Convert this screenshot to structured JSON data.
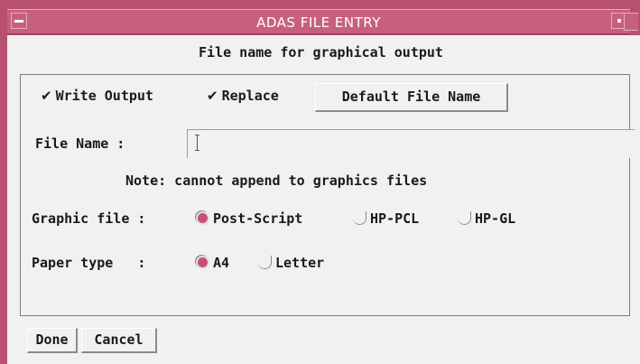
{
  "window": {
    "title": "ADAS FILE ENTRY"
  },
  "header": {
    "text": "File name for graphical output"
  },
  "options": {
    "write_output": {
      "label": "Write Output",
      "checked": true
    },
    "replace": {
      "label": "Replace",
      "checked": true
    },
    "default_button": "Default File Name"
  },
  "file_name": {
    "label": "File Name :",
    "value": ""
  },
  "note": "Note: cannot append to graphics files",
  "graphic_file": {
    "label": "Graphic file :",
    "options": [
      "Post-Script",
      "HP-PCL",
      "HP-GL"
    ],
    "selected": "Post-Script"
  },
  "paper_type": {
    "label": "Paper type   :",
    "options": [
      "A4",
      "Letter"
    ],
    "selected": "A4"
  },
  "footer": {
    "done": "Done",
    "cancel": "Cancel"
  },
  "colors": {
    "title_bar": "#c7607f",
    "frame": "#b8506f",
    "radio_on": "#c4527a",
    "background": "#f1f1f1"
  }
}
